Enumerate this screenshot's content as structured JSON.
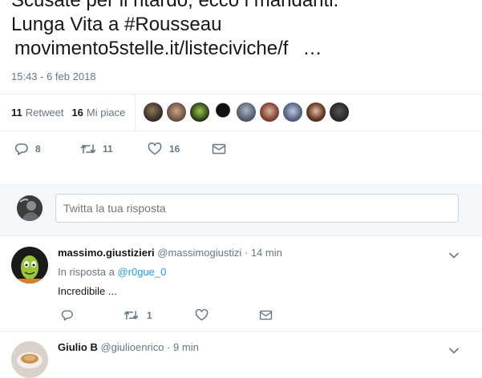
{
  "tweet": {
    "lines": [
      "Scusate per il ritardo, ecco i mandanti.",
      "Lunga Vita a #Rousseau"
    ],
    "link": "movimento5stelle.it/listeciviche/f",
    "link_ellipsis": "…",
    "timestamp": "15:43 - 6 feb 2018"
  },
  "stats": {
    "retweet_count": "11",
    "retweet_label": "Retweet",
    "like_count": "16",
    "like_label": "Mi piace"
  },
  "actions": {
    "reply_count": "8",
    "retweet_count": "11",
    "like_count": "16"
  },
  "reply_box": {
    "placeholder": "Twitta la tua risposta"
  },
  "replies": [
    {
      "name": "massimo.giustizieri",
      "handle": "@massimogiustizi",
      "dot": "·",
      "time": "14 min",
      "in_reply_prefix": "In risposta a",
      "in_reply_mention": "@r0gue_0",
      "text": "Incredibile ...",
      "retweet_count": "1"
    },
    {
      "name": "Giulio B",
      "handle": "@giulioenrico",
      "dot": "·",
      "time": "9 min"
    }
  ],
  "colors": {
    "accent": "#1da1f2",
    "muted": "#657786",
    "text": "#14171a"
  }
}
